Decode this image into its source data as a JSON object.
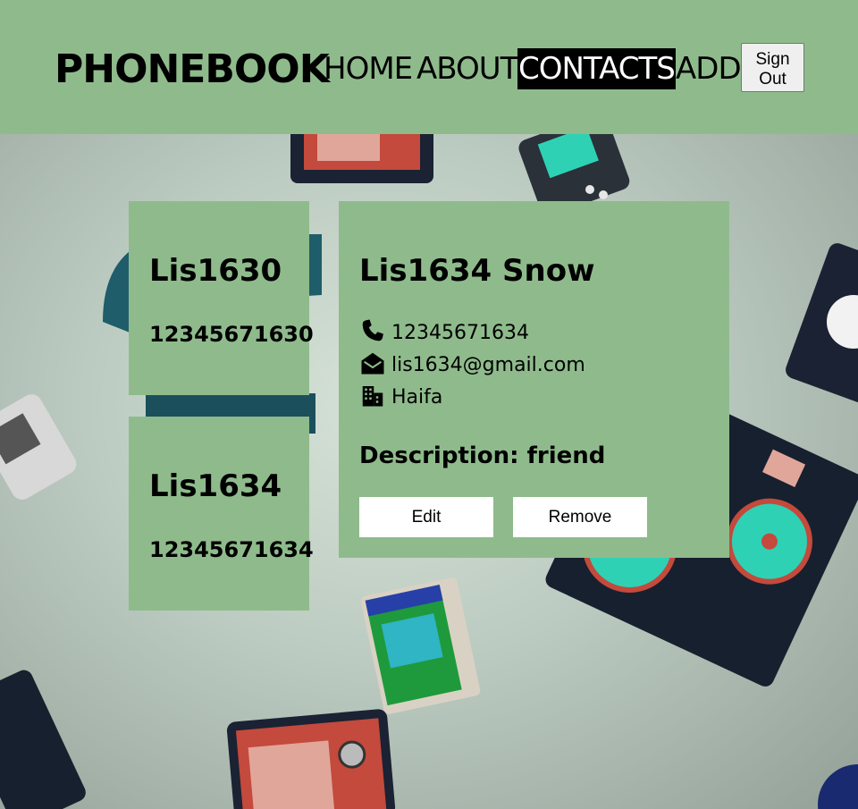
{
  "header": {
    "logo": "PHONEBOOK",
    "nav": {
      "home": "HOME",
      "about": "ABOUT",
      "contacts": "CONTACTS",
      "add": "ADD"
    },
    "active_nav": "contacts",
    "signout_line1": "Sign",
    "signout_line2": "Out"
  },
  "contacts": [
    {
      "name": "Lis1630",
      "phone": "12345671630"
    },
    {
      "name": "Lis1634",
      "phone": "12345671634"
    }
  ],
  "detail": {
    "name": "Lis1634 Snow",
    "phone": "12345671634",
    "email": "lis1634@gmail.com",
    "city": "Haifa",
    "description": "Description: friend",
    "edit_label": "Edit",
    "remove_label": "Remove",
    "icons": {
      "phone": "phone-icon",
      "email": "envelope-open-icon",
      "city": "building-icon"
    }
  },
  "colors": {
    "header_bg": "#8fbb8c",
    "card_bg": "#8fbb8c",
    "active_nav_bg": "#000000"
  }
}
